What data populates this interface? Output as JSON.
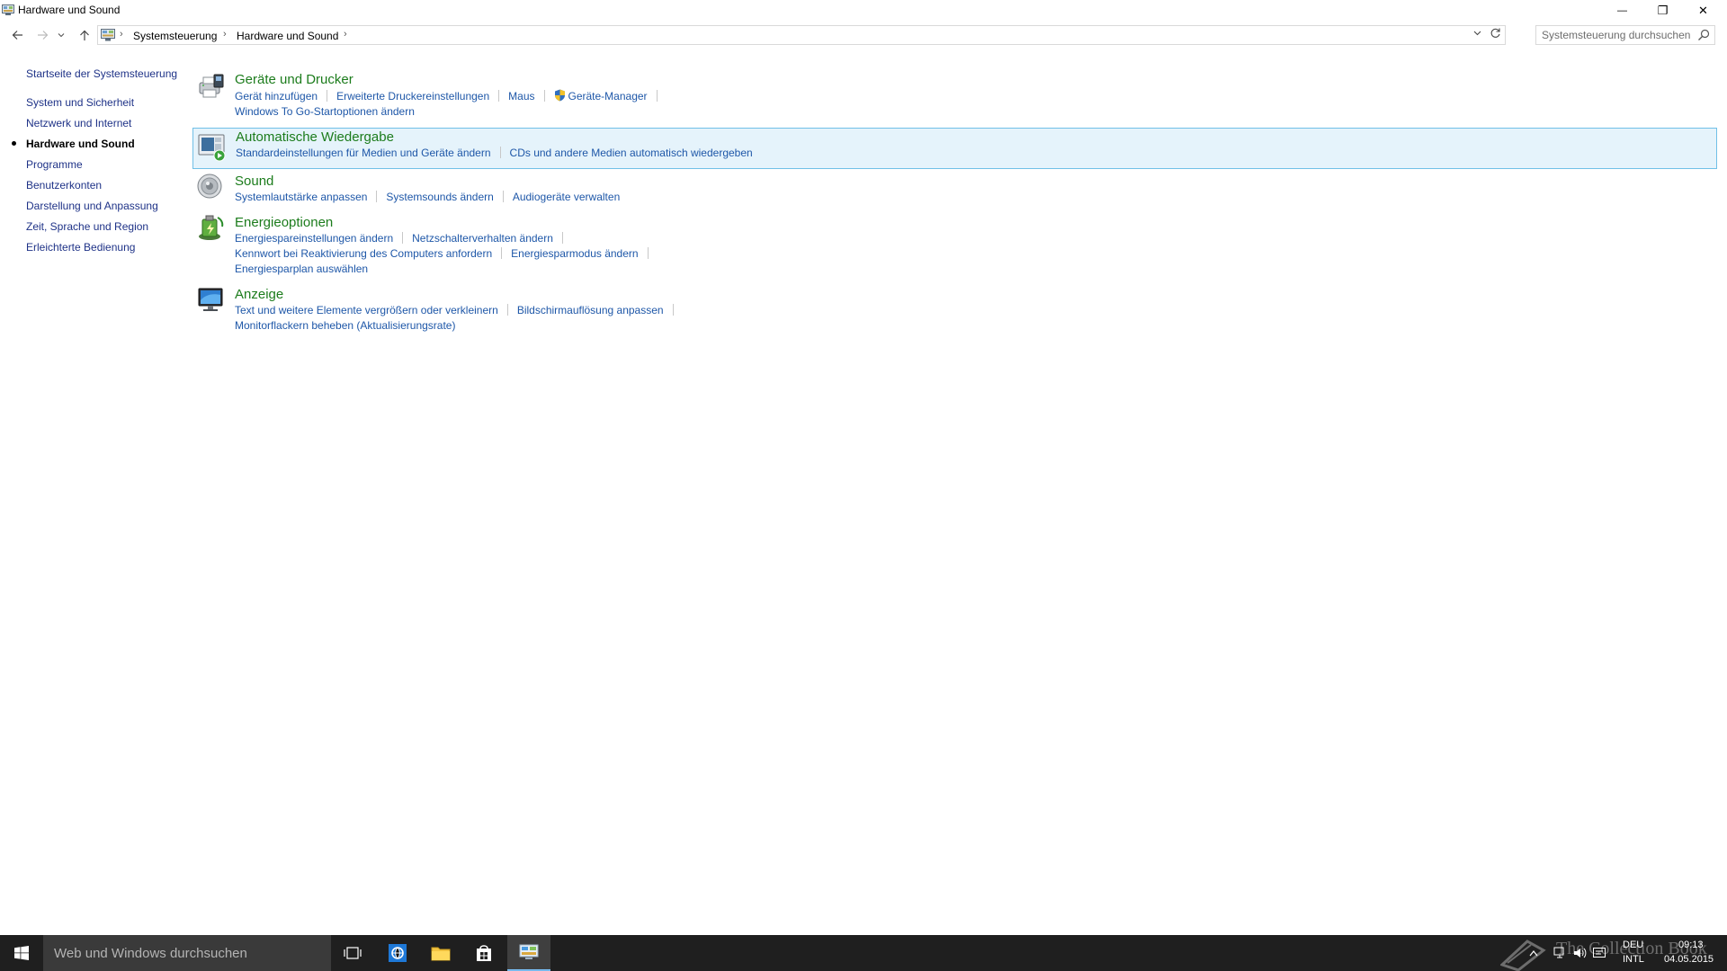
{
  "window": {
    "title": "Hardware und Sound",
    "controls": {
      "minimize": "—",
      "maximize": "❐",
      "close": "✕"
    }
  },
  "address": {
    "crumbs": [
      "Systemsteuerung",
      "Hardware und Sound"
    ],
    "separator": "›",
    "search_placeholder": "Systemsteuerung durchsuchen"
  },
  "nav": {
    "home": "Startseite der Systemsteuerung",
    "items": [
      "System und Sicherheit",
      "Netzwerk und Internet",
      "Hardware und Sound",
      "Programme",
      "Benutzerkonten",
      "Darstellung und Anpassung",
      "Zeit, Sprache und Region",
      "Erleichterte Bedienung"
    ],
    "active_index": 2
  },
  "categories": [
    {
      "title": "Geräte und Drucker",
      "icon": "devices-printers-icon",
      "lines": [
        [
          "Gerät hinzufügen",
          "Erweiterte Druckereinstellungen",
          "Maus",
          "Geräte-Manager"
        ],
        [
          "Windows To Go-Startoptionen ändern"
        ]
      ]
    },
    {
      "title": "Automatische Wiedergabe",
      "icon": "autoplay-icon",
      "lines": [
        [
          "Standardeinstellungen für Medien und Geräte ändern",
          "CDs und andere Medien automatisch wiedergeben"
        ]
      ]
    },
    {
      "title": "Sound",
      "icon": "sound-speaker-icon",
      "lines": [
        [
          "Systemlautstärke anpassen",
          "Systemsounds ändern",
          "Audiogeräte verwalten"
        ]
      ]
    },
    {
      "title": "Energieoptionen",
      "icon": "power-options-icon",
      "lines": [
        [
          "Energiespareinstellungen ändern",
          "Netzschalterverhalten ändern"
        ],
        [
          "Kennwort bei Reaktivierung des Computers anfordern",
          "Energiesparmodus ändern"
        ],
        [
          "Energiesparplan auswählen"
        ]
      ]
    },
    {
      "title": "Anzeige",
      "icon": "display-monitor-icon",
      "lines": [
        [
          "Text und weitere Elemente vergrößern oder verkleinern",
          "Bildschirmauflösung anpassen"
        ],
        [
          "Monitorflackern beheben (Aktualisierungsrate)"
        ]
      ]
    }
  ],
  "taskbar": {
    "search_placeholder": "Web und Windows durchsuchen",
    "apps": [
      "task-view-icon",
      "internet-explorer-icon",
      "file-explorer-icon",
      "store-icon",
      "control-panel-icon"
    ],
    "active_app": "control-panel-icon",
    "language": "DEU",
    "layout": "INTL",
    "time": "09:13",
    "date": "04.05.2015",
    "watermark": "The Collection Book"
  },
  "colors": {
    "category_title": "#1c7c1c",
    "task_link": "#1e57a8",
    "nav_link": "#1e3287",
    "highlight_bg": "#e5f3fb",
    "highlight_border": "#70c0e7",
    "taskbar": "#1f1f1f"
  }
}
